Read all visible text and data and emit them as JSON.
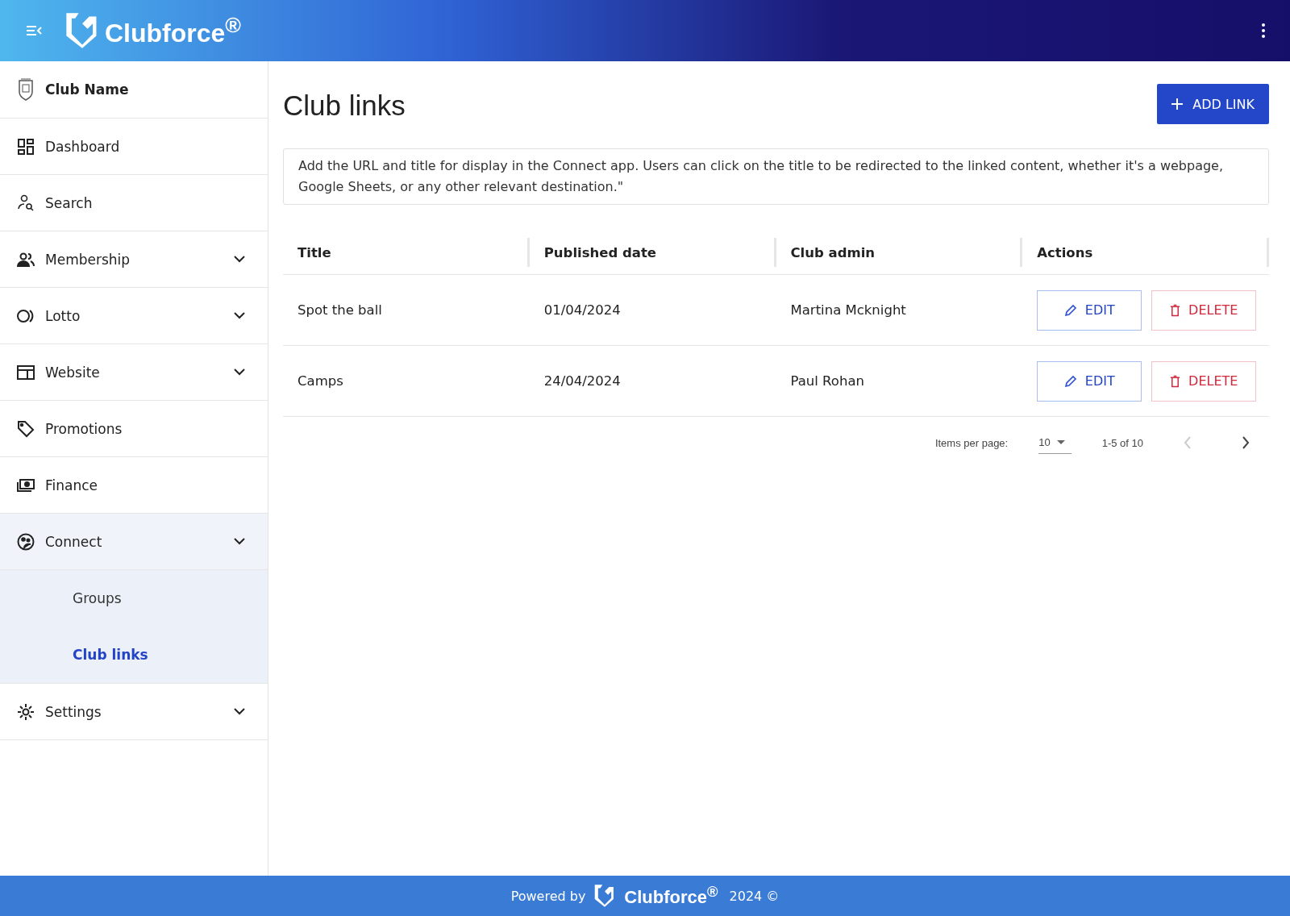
{
  "header": {
    "logo_text": "Clubforce$^{®}$"
  },
  "sidebar": {
    "club_name": "Club Name",
    "items": [
      {
        "label": "Dashboard",
        "expandable": false,
        "expanded": false
      },
      {
        "label": "Search",
        "expandable": false,
        "expanded": false
      },
      {
        "label": "Membership",
        "expandable": true,
        "expanded": false
      },
      {
        "label": "Lotto",
        "expandable": true,
        "expanded": false
      },
      {
        "label": "Website",
        "expandable": true,
        "expanded": false
      },
      {
        "label": "Promotions",
        "expandable": false,
        "expanded": false
      },
      {
        "label": "Finance",
        "expandable": false,
        "expanded": false
      },
      {
        "label": "Connect",
        "expandable": true,
        "expanded": true,
        "children": [
          {
            "label": "Groups",
            "selected": false
          },
          {
            "label": "Club links",
            "selected": true
          }
        ]
      },
      {
        "label": "Settings",
        "expandable": true,
        "expanded": false
      }
    ]
  },
  "page": {
    "title": "Club links",
    "add_button": "ADD LINK",
    "info": "Add the URL and title for display in the Connect app. Users can click on the title to be redirected to the linked content, whether it's a webpage, Google Sheets, or any other relevant destination.\""
  },
  "table": {
    "columns": [
      "Title",
      "Published date",
      "Club admin",
      "Actions"
    ],
    "rows": [
      {
        "title": "Spot the ball",
        "published_date": "01/04/2024",
        "club_admin": "Martina Mcknight",
        "edit": "EDIT",
        "delete": "DELETE"
      },
      {
        "title": "Camps",
        "published_date": "24/04/2024",
        "club_admin": "Paul Rohan",
        "edit": "EDIT",
        "delete": "DELETE"
      }
    ]
  },
  "pagination": {
    "items_per_page_label": "Items per page:",
    "page_size": "10",
    "range": "1-5 of 10",
    "prev_disabled": true,
    "next_disabled": false
  },
  "footer": {
    "powered_by": "Powered by",
    "logo_text": "Clubforce$^{®}$",
    "year": "2024 ©"
  }
}
